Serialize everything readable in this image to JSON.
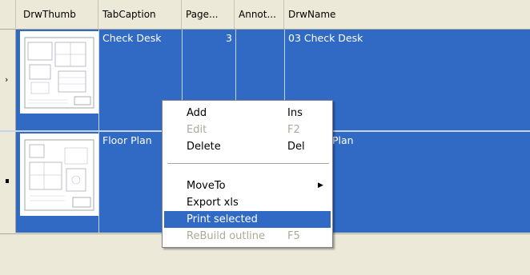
{
  "grid": {
    "columns": [
      "DrwThumb",
      "TabCaption",
      "Page...",
      "Annot...",
      "DrwName"
    ],
    "rows": [
      {
        "tab_caption": "Check Desk",
        "page": "3",
        "annot": "",
        "drw_name": "03 Check Desk",
        "current": true
      },
      {
        "tab_caption": "Floor Plan",
        "page": "",
        "annot": "",
        "drw_name": "04 Floor Plan",
        "current": false
      }
    ]
  },
  "row_indicator": {
    "current_glyph": "›"
  },
  "context_menu": {
    "items": [
      {
        "label": "Add",
        "shortcut": "Ins",
        "enabled": true
      },
      {
        "label": "Edit",
        "shortcut": "F2",
        "enabled": false
      },
      {
        "label": "Delete",
        "shortcut": "Del",
        "enabled": true
      },
      {
        "label": "MoveTo",
        "shortcut": "",
        "enabled": true,
        "submenu_glyph": "▶"
      },
      {
        "label": "Export xls",
        "shortcut": "",
        "enabled": true
      },
      {
        "label": "Print selected",
        "shortcut": "",
        "enabled": true,
        "highlighted": true
      },
      {
        "label": "ReBuild outline",
        "shortcut": "F5",
        "enabled": false
      }
    ]
  },
  "colors": {
    "selection": "#316ac5",
    "background": "#ece9d8",
    "disabled_text": "#aca899"
  }
}
